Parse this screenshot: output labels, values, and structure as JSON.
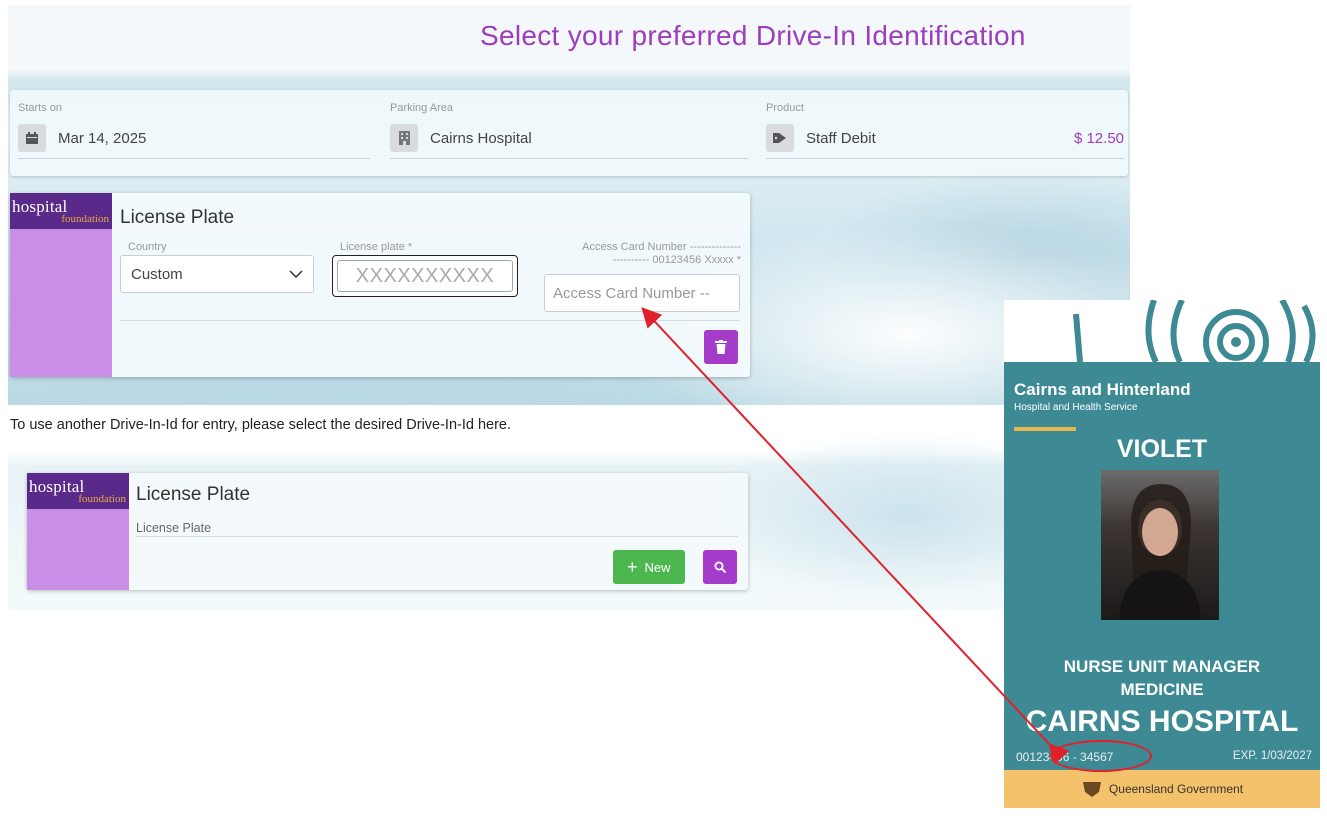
{
  "header": {
    "title": "Select your preferred Drive-In Identification"
  },
  "filters": {
    "starts_on": {
      "label": "Starts on",
      "value": "Mar 14, 2025",
      "icon": "calendar-icon"
    },
    "parking_area": {
      "label": "Parking Area",
      "value": "Cairns Hospital",
      "icon": "building-icon"
    },
    "product": {
      "label": "Product",
      "value": "Staff Debit",
      "price": "$ 12.50",
      "icon": "tag-icon"
    }
  },
  "brand": {
    "word": "hospital",
    "sub": "foundation"
  },
  "plate_card": {
    "title": "License Plate",
    "country_label": "Country",
    "country_value": "Custom",
    "plate_label": "License plate *",
    "plate_placeholder": "XXXXXXXXXX",
    "access_label_line1": "Access Card Number --------------",
    "access_label_line2": "---------- 00123456 Xxxxx *",
    "access_placeholder": "Access Card Number --",
    "delete_icon": "trash-icon"
  },
  "hint": "To use another Drive-In-Id for entry, please select the desired Drive-In-Id here.",
  "other_card": {
    "title": "License Plate",
    "sub_label": "License Plate",
    "new_label": "New",
    "search_icon": "search-icon"
  },
  "id_card": {
    "org_line1": "Cairns and Hinterland",
    "org_line2": "Hospital and Health Service",
    "name": "VIOLET",
    "role_line1": "NURSE UNIT MANAGER",
    "role_line2": "MEDICINE",
    "hospital": "CAIRNS HOSPITAL",
    "number": "00123456 - 34567",
    "expiry": "EXP. 1/03/2027",
    "government": "Queensland Government"
  },
  "colors": {
    "accent": "#9b3dbd",
    "button_purple": "#a43cc9",
    "button_green": "#4cb64f",
    "brand_dark": "#5a2a8a",
    "brand_light": "#c98fe6",
    "arrow": "#e0202a"
  }
}
